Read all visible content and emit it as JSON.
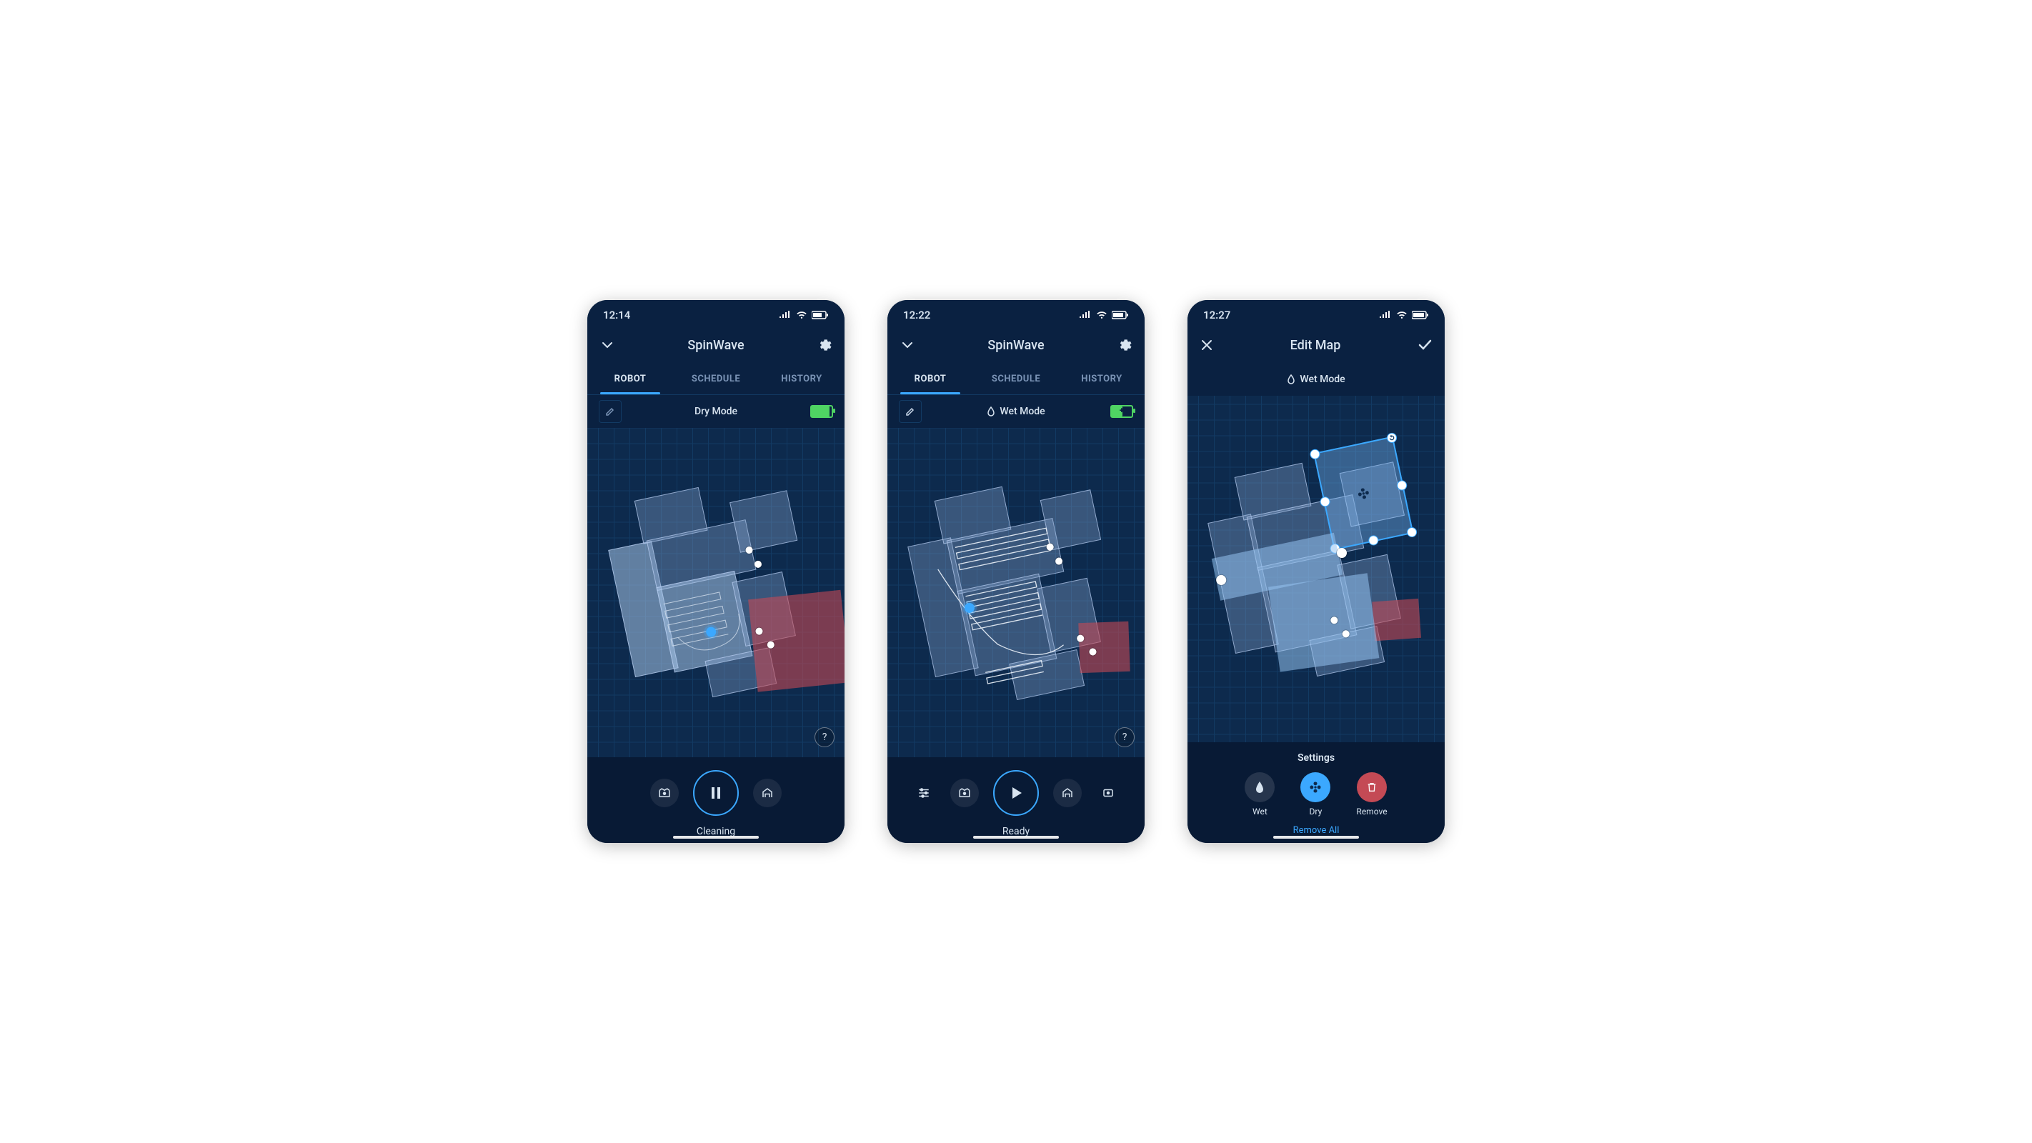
{
  "screens": [
    {
      "status": {
        "time": "12:14"
      },
      "header": {
        "title": "SpinWave",
        "left_icon": "chevron-down",
        "right_icon": "gear"
      },
      "tabs": [
        "ROBOT",
        "SCHEDULE",
        "HISTORY"
      ],
      "active_tab": 0,
      "mode_label": "Dry Mode",
      "mode_icon": "none",
      "battery": {
        "pct": 90,
        "charging": false
      },
      "controls": {
        "status": "Cleaning",
        "main": "pause",
        "left": [
          "clean-map"
        ],
        "right": [
          "home"
        ],
        "sides": false
      },
      "help": true
    },
    {
      "status": {
        "time": "12:22"
      },
      "header": {
        "title": "SpinWave",
        "left_icon": "chevron-down",
        "right_icon": "gear"
      },
      "tabs": [
        "ROBOT",
        "SCHEDULE",
        "HISTORY"
      ],
      "active_tab": 0,
      "mode_label": "Wet Mode",
      "mode_icon": "droplet",
      "battery": {
        "pct": 70,
        "charging": true
      },
      "controls": {
        "status": "Ready",
        "main": "play",
        "left": [
          "sliders",
          "clean-map"
        ],
        "right": [
          "home",
          "camera"
        ],
        "sides": true
      },
      "help": true
    },
    {
      "status": {
        "time": "12:27"
      },
      "header": {
        "title": "Edit Map",
        "left_icon": "close",
        "right_icon": "check"
      },
      "mode_label": "Wet Mode",
      "mode_icon": "droplet",
      "edit": true,
      "panel": {
        "title": "Settings",
        "options": [
          {
            "label": "Wet",
            "icon": "droplet",
            "style": "dim"
          },
          {
            "label": "Dry",
            "icon": "fan",
            "style": "sel"
          },
          {
            "label": "Remove",
            "icon": "trash",
            "style": "red"
          }
        ],
        "remove_all": "Remove All"
      }
    }
  ]
}
